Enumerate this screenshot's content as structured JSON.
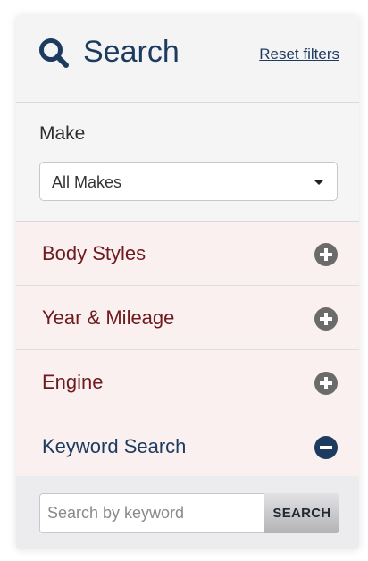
{
  "header": {
    "title": "Search",
    "reset_label": "Reset filters"
  },
  "make": {
    "label": "Make",
    "selected": "All Makes"
  },
  "accordion": {
    "items": [
      {
        "label": "Body Styles",
        "state": "collapsed",
        "icon": "plus-circle-icon"
      },
      {
        "label": "Year & Mileage",
        "state": "collapsed",
        "icon": "plus-circle-icon"
      },
      {
        "label": "Engine",
        "state": "collapsed",
        "icon": "plus-circle-icon"
      },
      {
        "label": "Keyword Search",
        "state": "expanded",
        "icon": "minus-circle-icon"
      }
    ]
  },
  "keyword": {
    "placeholder": "Search by keyword",
    "value": "",
    "button_label": "SEARCH"
  },
  "colors": {
    "navy": "#1d3a5f",
    "maroon": "#6e1a1f",
    "accordion_bg": "#faf0f0",
    "icon_gray": "#6b6b6b"
  }
}
